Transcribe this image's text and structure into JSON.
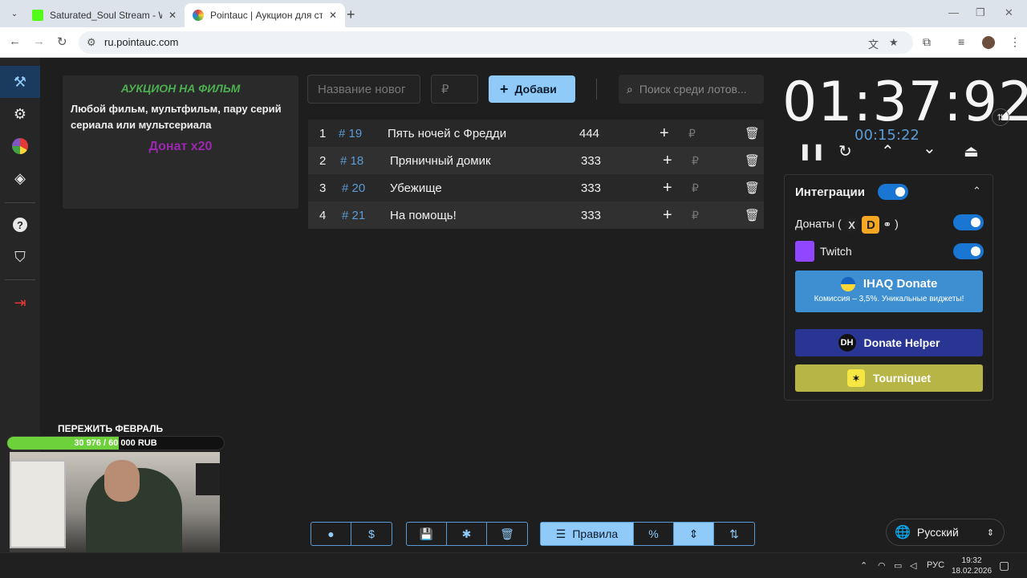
{
  "browser": {
    "tabs": [
      {
        "title": "Saturated_Soul Stream - Watch",
        "favicon_color": "#53fc18"
      },
      {
        "title": "Pointauc | Аукцион для стриме",
        "favicon_color": "#9c27b0"
      }
    ],
    "url": "ru.pointauc.com"
  },
  "rules": {
    "title": "АУКЦИОН НА ФИЛЬМ",
    "text": "Любой фильм, мультфильм, пару серий сериала или мультсериала",
    "donat": "Донат х20"
  },
  "toolbar": {
    "name_placeholder": "Название новог",
    "amount_placeholder": "₽",
    "add_label": "Добави",
    "search_placeholder": "Поиск среди лотов..."
  },
  "lots": [
    {
      "num": "1",
      "id": "# 19",
      "name": "Пять ночей с Фредди",
      "amount": "444"
    },
    {
      "num": "2",
      "id": "# 18",
      "name": "Пряничный домик",
      "amount": "333"
    },
    {
      "num": "3",
      "id": "# 20",
      "name": "Убежище",
      "amount": "333"
    },
    {
      "num": "4",
      "id": "# 21",
      "name": "На помощь!",
      "amount": "333"
    }
  ],
  "currency": "₽",
  "timer": {
    "main": "01:37:92",
    "sub": "00:15:22"
  },
  "integrations": {
    "title": "Интеграции",
    "donations_label": "Донаты (",
    "donations_suffix": ")",
    "twitch_label": "Twitch",
    "ihaq_title": "IHAQ Donate",
    "ihaq_subtitle": "Комиссия – 3,5%. Уникальные виджеты!",
    "donate_helper": "Donate Helper",
    "dh_badge": "DH",
    "tourniquet": "Tourniquet"
  },
  "bottom": {
    "rules_label": "Правила",
    "percent_label": "%"
  },
  "language": "Русский",
  "stream_overlay": {
    "title": "ПЕРЕЖИТЬ ФЕВРАЛЬ",
    "progress_text": "30 976 / 60 000 RUB",
    "progress_fraction": 0.516
  },
  "taskbar": {
    "lang": "РУС",
    "time": "19:32",
    "date": "18.02.2026"
  },
  "colors": {
    "accent": "#90caf9",
    "primary": "#1976d2",
    "ihaq": "#3d8fd1",
    "donate_helper": "#283593",
    "tourniquet": "#b7b545"
  }
}
